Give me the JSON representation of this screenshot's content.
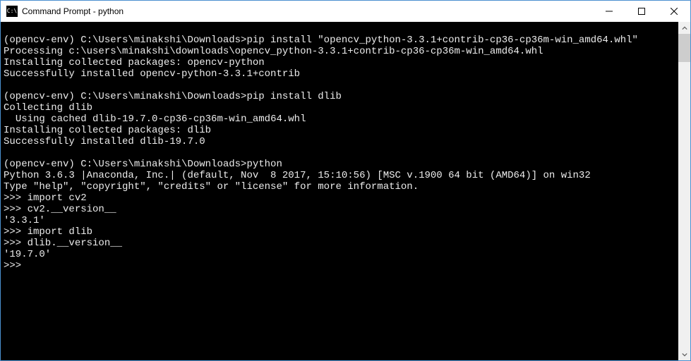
{
  "window": {
    "title": "Command Prompt - python"
  },
  "terminal": {
    "lines": [
      "",
      "(opencv-env) C:\\Users\\minakshi\\Downloads>pip install \"opencv_python-3.3.1+contrib-cp36-cp36m-win_amd64.whl\"",
      "Processing c:\\users\\minakshi\\downloads\\opencv_python-3.3.1+contrib-cp36-cp36m-win_amd64.whl",
      "Installing collected packages: opencv-python",
      "Successfully installed opencv-python-3.3.1+contrib",
      "",
      "(opencv-env) C:\\Users\\minakshi\\Downloads>pip install dlib",
      "Collecting dlib",
      "  Using cached dlib-19.7.0-cp36-cp36m-win_amd64.whl",
      "Installing collected packages: dlib",
      "Successfully installed dlib-19.7.0",
      "",
      "(opencv-env) C:\\Users\\minakshi\\Downloads>python",
      "Python 3.6.3 |Anaconda, Inc.| (default, Nov  8 2017, 15:10:56) [MSC v.1900 64 bit (AMD64)] on win32",
      "Type \"help\", \"copyright\", \"credits\" or \"license\" for more information.",
      ">>> import cv2",
      ">>> cv2.__version__",
      "'3.3.1'",
      ">>> import dlib",
      ">>> dlib.__version__",
      "'19.7.0'",
      ">>>"
    ]
  }
}
